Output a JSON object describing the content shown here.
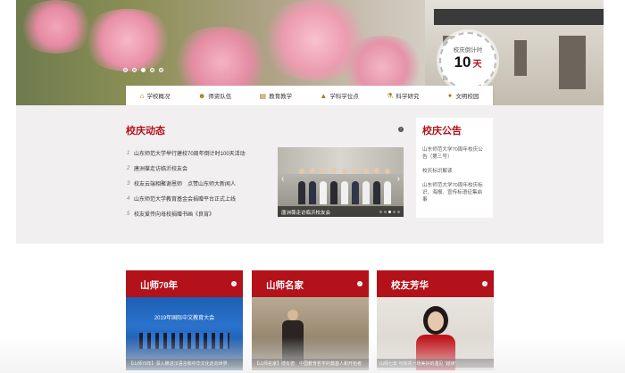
{
  "hero": {
    "countdown_label": "校庆倒计时",
    "countdown_value": "10",
    "countdown_unit": "天",
    "slide_count": 5,
    "active_slide": 1
  },
  "nav": {
    "items": [
      {
        "label": "学校概况",
        "icon": "school-icon"
      },
      {
        "label": "师资队伍",
        "icon": "people-icon"
      },
      {
        "label": "教育教学",
        "icon": "book-icon"
      },
      {
        "label": "学科学位点",
        "icon": "graduation-cap-icon"
      },
      {
        "label": "科学研究",
        "icon": "flask-icon"
      },
      {
        "label": "文明校园",
        "icon": "star-icon"
      }
    ]
  },
  "news": {
    "title": "校庆动态",
    "items": [
      {
        "num": "1",
        "text": "山东师范大学举行建校70周年倒计时100天活动"
      },
      {
        "num": "2",
        "text": "唐洲葆走访临沂校友会"
      },
      {
        "num": "3",
        "text": "校友云端相聚谢恩师　点赞山东师大新闻人"
      },
      {
        "num": "4",
        "text": "山东师范大学教育基金会捐赠平台正式上线"
      },
      {
        "num": "5",
        "text": "校友爱传向母校捐赠书画《良宵》"
      }
    ],
    "photo_caption": "唐洲葆走访临沂校友会"
  },
  "notice": {
    "title": "校庆公告",
    "items": [
      "山东师范大学70周年校庆公告（第三号）",
      "校庆标识解读",
      "山东师范大学70周年校庆标识、海报、宣传标语征集启事"
    ]
  },
  "cards": [
    {
      "title": "山师70年",
      "caption": "【山师70年】深入推进汉语言和中华文化走向世界"
    },
    {
      "title": "山师名家",
      "caption": "【山师名家】傅有德：中国教育哲学的奠基人和开拓者"
    },
    {
      "title": "校友芳华",
      "caption": "山师七年 与你共一场美好的遇见 “越读”"
    }
  ],
  "card_image_text": {
    "banner": "2019年国际中文教育大会"
  },
  "colors": {
    "accent": "#b3121b",
    "band": "#f1eff0",
    "nav_icon": "#a8751b"
  }
}
